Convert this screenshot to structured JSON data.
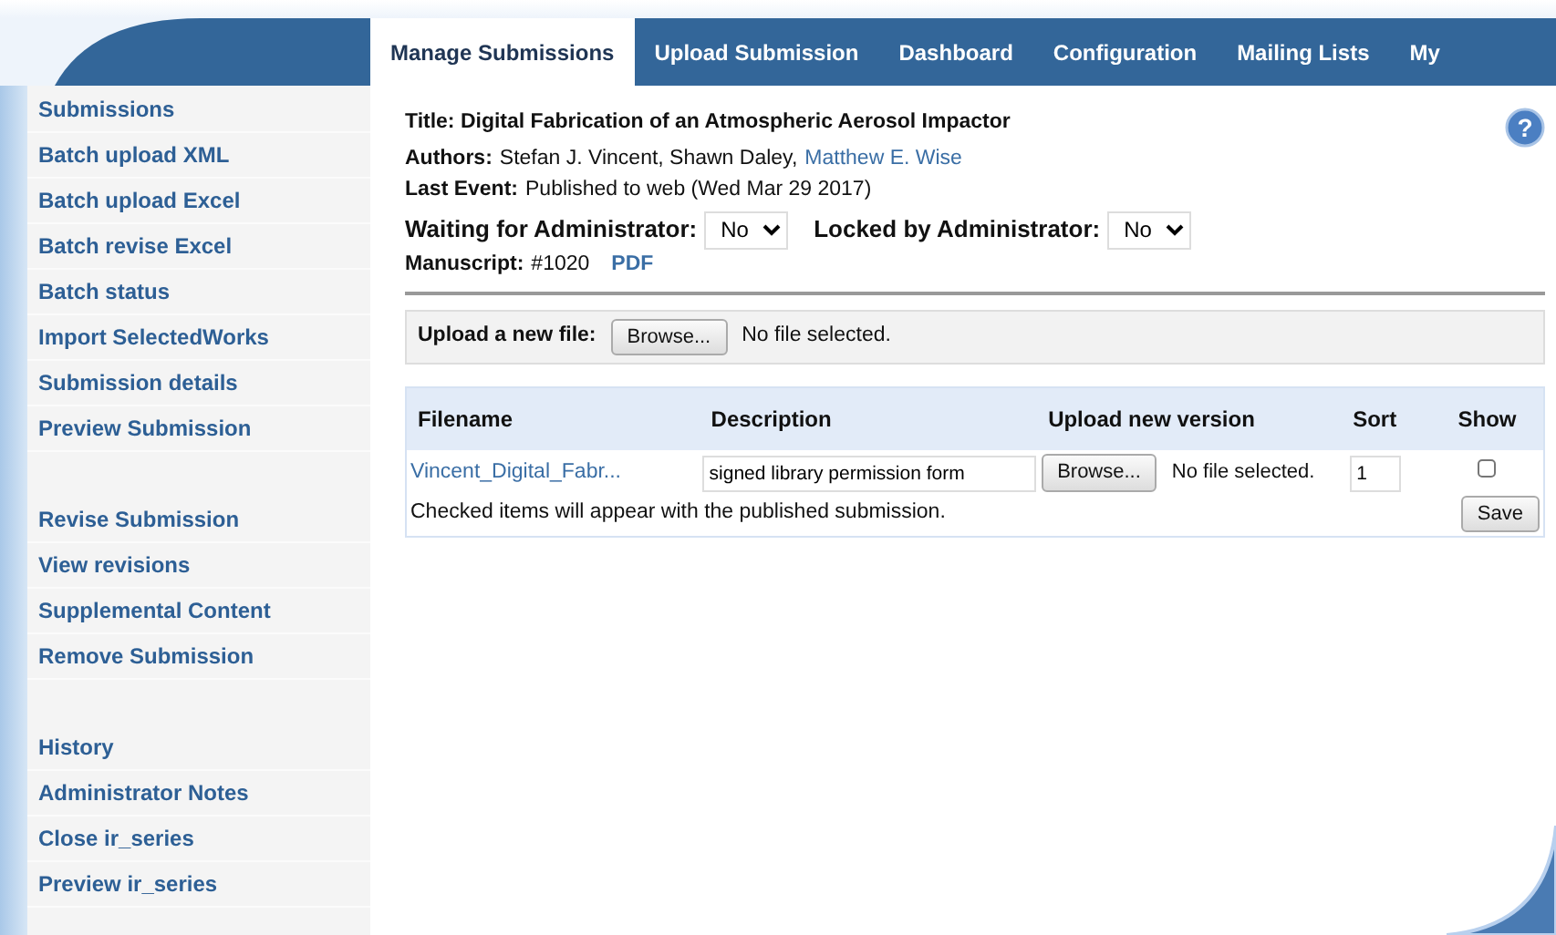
{
  "tabs": [
    {
      "label": "Manage Submissions",
      "selected": true
    },
    {
      "label": "Upload Submission",
      "selected": false
    },
    {
      "label": "Dashboard",
      "selected": false
    },
    {
      "label": "Configuration",
      "selected": false
    },
    {
      "label": "Mailing Lists",
      "selected": false
    },
    {
      "label": "My",
      "selected": false
    }
  ],
  "sidebar": {
    "groups": [
      {
        "items": [
          {
            "label": "Submissions"
          },
          {
            "label": "Batch upload XML"
          },
          {
            "label": "Batch upload Excel"
          },
          {
            "label": "Batch revise Excel"
          },
          {
            "label": "Batch status"
          },
          {
            "label": "Import SelectedWorks"
          },
          {
            "label": "Submission details"
          },
          {
            "label": "Preview Submission"
          }
        ]
      },
      {
        "items": [
          {
            "label": "Revise Submission"
          },
          {
            "label": "View revisions"
          },
          {
            "label": "Supplemental Content"
          },
          {
            "label": "Remove Submission"
          }
        ]
      },
      {
        "items": [
          {
            "label": "History"
          },
          {
            "label": "Administrator Notes"
          },
          {
            "label": "Close ir_series"
          },
          {
            "label": "Preview ir_series"
          }
        ]
      }
    ]
  },
  "help_icon": "?",
  "submission": {
    "title": "Title: Digital Fabrication of an Atmospheric Aerosol Impactor",
    "authors_label": "Authors:",
    "authors": "Stefan J. Vincent, Shawn Daley,",
    "author_link": "Matthew E. Wise",
    "last_event_label": "Last Event:",
    "last_event": "Published to web (Wed Mar 29 2017)",
    "waiting_label": "Waiting for Administrator:",
    "waiting_value": "No",
    "locked_label": "Locked by Administrator:",
    "locked_value": "No",
    "manuscript_label": "Manuscript:",
    "manuscript": "#1020",
    "pdf_link": "PDF"
  },
  "upload": {
    "label": "Upload a new file:",
    "button": "Browse...",
    "status": "No file selected."
  },
  "files": {
    "columns": [
      "Filename",
      "Description",
      "Upload new version",
      "Sort",
      "Show"
    ],
    "rows": [
      {
        "filename": "Vincent_Digital_Fabr...",
        "description": "signed library permission form",
        "button": "Browse...",
        "status": "No file selected.",
        "sort": "1",
        "show": false
      }
    ],
    "note": "Checked items will appear with the published submission.",
    "save": "Save"
  }
}
